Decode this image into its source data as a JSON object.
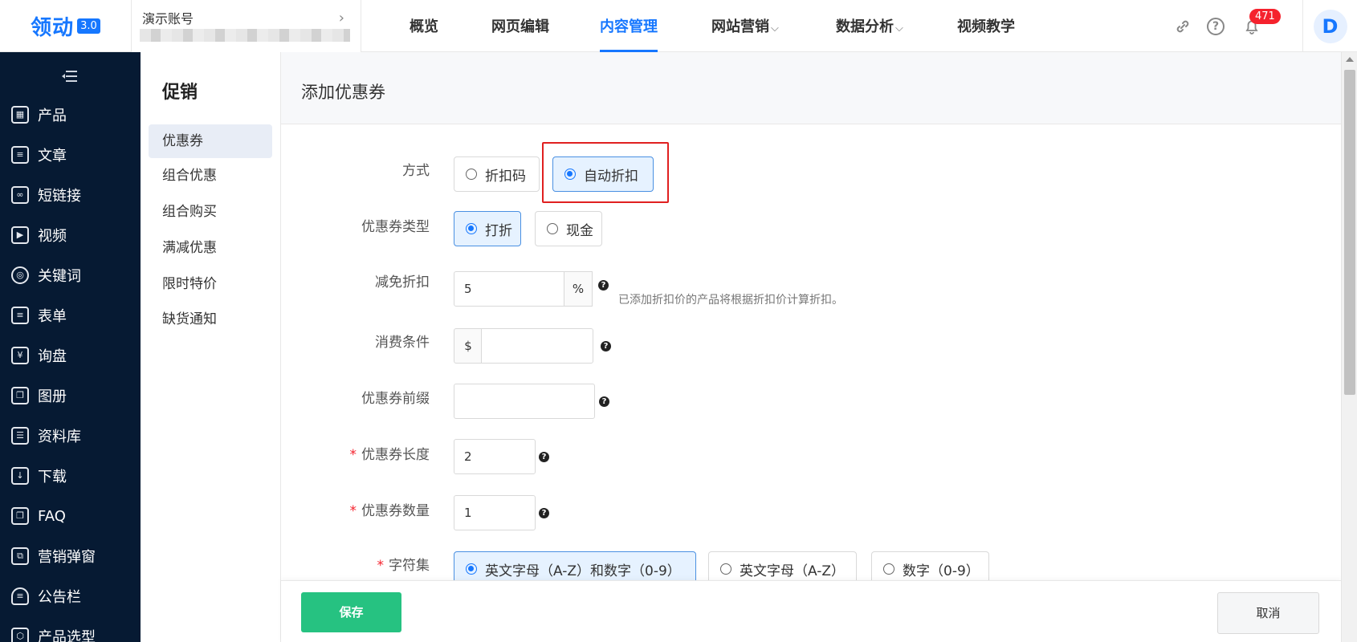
{
  "logo": {
    "text": "领动",
    "badge": "3.0"
  },
  "account": {
    "name": "演示账号",
    "arrow": "›"
  },
  "nav": {
    "items": [
      {
        "label": "概览",
        "caret": ""
      },
      {
        "label": "网页编辑",
        "caret": ""
      },
      {
        "label": "内容管理",
        "caret": "",
        "active": true
      },
      {
        "label": "网站营销",
        "caret": "⌵"
      },
      {
        "label": "数据分析",
        "caret": "⌵"
      },
      {
        "label": "视频教学",
        "caret": ""
      }
    ]
  },
  "header_icons": {
    "link": "link-icon",
    "help": "?",
    "bell": "bell-icon",
    "notification_count": "471"
  },
  "user": {
    "avatar_letter": "D"
  },
  "sidebar": {
    "items": [
      {
        "label": "产品",
        "icon": "grid-icon"
      },
      {
        "label": "文章",
        "icon": "document-icon"
      },
      {
        "label": "短链接",
        "icon": "link-icon"
      },
      {
        "label": "视频",
        "icon": "video-icon"
      },
      {
        "label": "关键词",
        "icon": "target-icon"
      },
      {
        "label": "表单",
        "icon": "clipboard-icon"
      },
      {
        "label": "询盘",
        "icon": "inquiry-icon"
      },
      {
        "label": "图册",
        "icon": "album-icon"
      },
      {
        "label": "资料库",
        "icon": "database-icon"
      },
      {
        "label": "下载",
        "icon": "download-icon"
      },
      {
        "label": "FAQ",
        "icon": "faq-icon"
      },
      {
        "label": "营销弹窗",
        "icon": "popup-icon"
      },
      {
        "label": "公告栏",
        "icon": "notice-icon"
      },
      {
        "label": "产品选型",
        "icon": "product-select-icon"
      }
    ]
  },
  "submenu": {
    "title": "促销",
    "items": [
      {
        "label": "优惠券",
        "active": true
      },
      {
        "label": "组合优惠"
      },
      {
        "label": "组合购买"
      },
      {
        "label": "满减优惠"
      },
      {
        "label": "限时特价"
      },
      {
        "label": "缺货通知"
      }
    ]
  },
  "page": {
    "title": "添加优惠券"
  },
  "form": {
    "method": {
      "label": "方式",
      "options": [
        "折扣码",
        "自动折扣"
      ],
      "selected": "自动折扣"
    },
    "coupon_type": {
      "label": "优惠券类型",
      "options": [
        "打折",
        "现金"
      ],
      "selected": "打折"
    },
    "discount": {
      "label": "减免折扣",
      "value": "5",
      "suffix": "%",
      "hint": "已添加折扣价的产品将根据折扣价计算折扣。"
    },
    "condition": {
      "label": "消费条件",
      "prefix": "$",
      "value": ""
    },
    "prefix": {
      "label": "优惠券前缀",
      "value": ""
    },
    "length": {
      "label": "优惠券长度",
      "required": "*",
      "value": "2"
    },
    "quantity": {
      "label": "优惠券数量",
      "required": "*",
      "value": "1"
    },
    "charset": {
      "label": "字符集",
      "required": "*",
      "options": [
        "英文字母（A-Z）和数字（0-9）",
        "英文字母（A-Z）",
        "数字（0-9）"
      ],
      "selected": "英文字母（A-Z）和数字（0-9）"
    }
  },
  "footer": {
    "save_label": "保存",
    "cancel_label": "取消"
  },
  "colors": {
    "primary": "#1677ff",
    "save": "#26c281",
    "sidebar": "#061a33",
    "highlight_box": "#e02020"
  }
}
